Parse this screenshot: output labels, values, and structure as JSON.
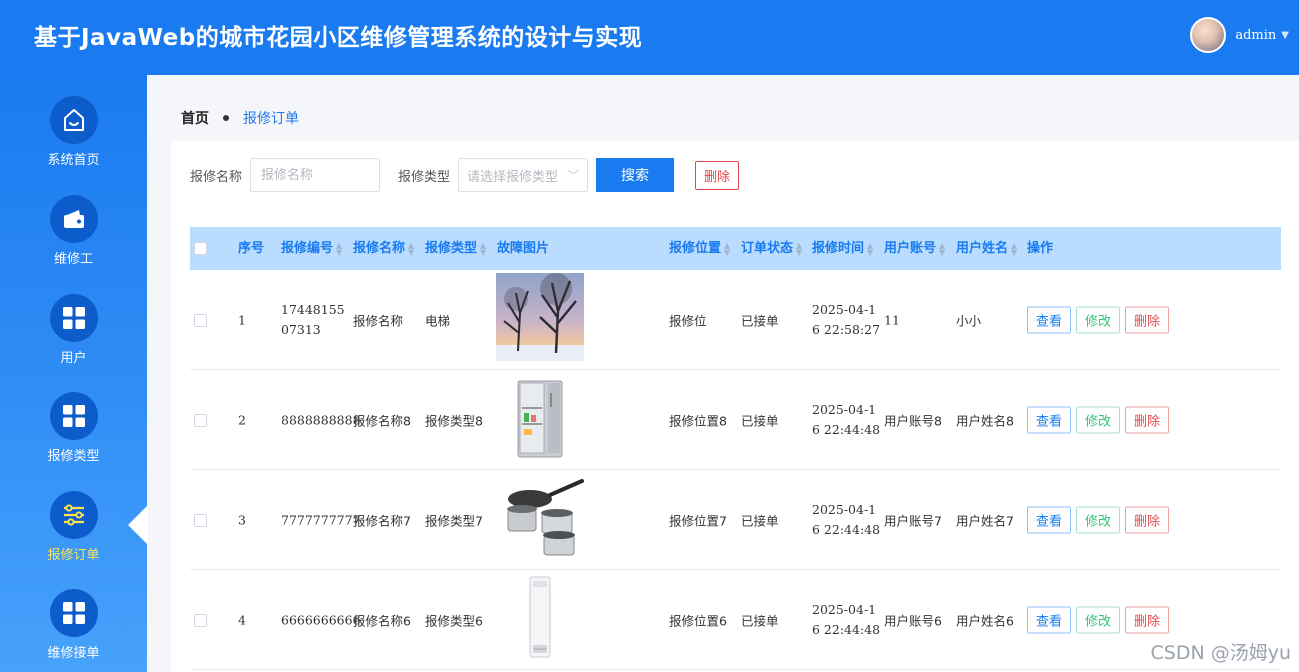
{
  "header": {
    "title": "基于JavaWeb的城市花园小区维修管理系统的设计与实现",
    "username": "admin"
  },
  "sidebar": {
    "items": [
      {
        "label": "系统首页",
        "icon": "home-icon"
      },
      {
        "label": "维修工",
        "icon": "wallet-icon"
      },
      {
        "label": "用户",
        "icon": "grid-icon"
      },
      {
        "label": "报修类型",
        "icon": "grid-icon"
      },
      {
        "label": "报修订单",
        "icon": "sliders-icon",
        "active": true
      },
      {
        "label": "维修接单",
        "icon": "grid-icon"
      }
    ]
  },
  "breadcrumb": {
    "home": "首页",
    "current": "报修订单"
  },
  "search": {
    "name_label": "报修名称",
    "name_placeholder": "报修名称",
    "type_label": "报修类型",
    "type_placeholder": "请选择报修类型",
    "search_button": "搜索",
    "delete_button": "删除"
  },
  "table": {
    "headers": [
      "序号",
      "报修编号",
      "报修名称",
      "报修类型",
      "故障图片",
      "报修位置",
      "订单状态",
      "报修时间",
      "用户账号",
      "用户姓名",
      "操作"
    ],
    "rows": [
      {
        "index": "1",
        "code": "1744815507313",
        "name": "报修名称",
        "type": "电梯",
        "image": "winter-tree-photo",
        "location": "报修位",
        "status": "已接单",
        "time": "2025-04-16 22:58:27",
        "account": "11",
        "username": "小小"
      },
      {
        "index": "2",
        "code": "8888888888",
        "name": "报修名称8",
        "type": "报修类型8",
        "image": "refrigerator-photo",
        "location": "报修位置8",
        "status": "已接单",
        "time": "2025-04-16 22:44:48",
        "account": "用户账号8",
        "username": "用户姓名8"
      },
      {
        "index": "3",
        "code": "7777777777",
        "name": "报修名称7",
        "type": "报修类型7",
        "image": "cookware-photo",
        "location": "报修位置7",
        "status": "已接单",
        "time": "2025-04-16 22:44:48",
        "account": "用户账号7",
        "username": "用户姓名7"
      },
      {
        "index": "4",
        "code": "6666666666",
        "name": "报修名称6",
        "type": "报修类型6",
        "image": "air-conditioner-photo",
        "location": "报修位置6",
        "status": "已接单",
        "time": "2025-04-16 22:44:48",
        "account": "用户账号6",
        "username": "用户姓名6"
      }
    ],
    "actions": {
      "view": "查看",
      "edit": "修改",
      "delete": "删除"
    }
  },
  "watermark": "CSDN @汤姆yu"
}
